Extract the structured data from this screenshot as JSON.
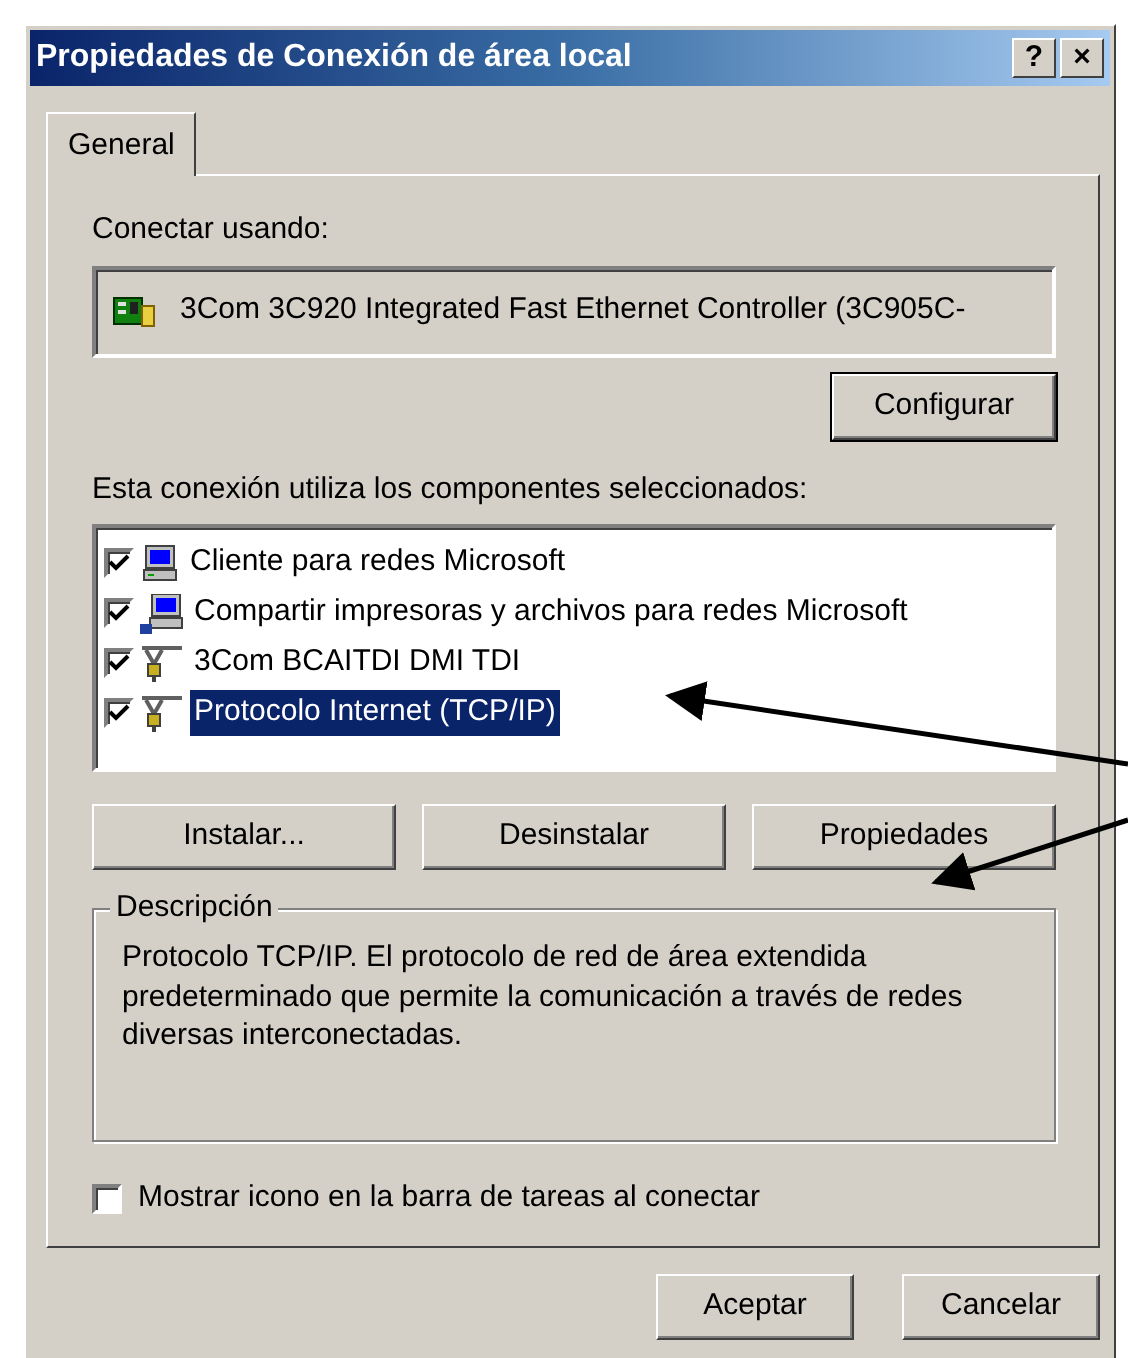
{
  "window": {
    "title": "Propiedades de Conexión de área local",
    "title_buttons": [
      "?",
      "×"
    ]
  },
  "tabs": [
    {
      "label": "General",
      "selected": true
    }
  ],
  "connect_label": "Conectar usando:",
  "adapter": {
    "name": "3Com 3C920 Integrated Fast Ethernet Controller (3C905C-"
  },
  "configure_button": "Configurar",
  "components_label": "Esta conexión utiliza los componentes seleccionados:",
  "components": [
    {
      "label": "Cliente para redes Microsoft",
      "kind": "client",
      "checked": true,
      "selected": false
    },
    {
      "label": "Compartir impresoras y archivos para redes Microsoft",
      "kind": "share",
      "checked": true,
      "selected": false
    },
    {
      "label": "3Com BCAITDI DMI TDI",
      "kind": "protocol",
      "checked": true,
      "selected": false
    },
    {
      "label": "Protocolo Internet (TCP/IP)",
      "kind": "protocol",
      "checked": true,
      "selected": true
    }
  ],
  "component_buttons": [
    "Instalar...",
    "Desinstalar",
    "Propiedades"
  ],
  "description": {
    "title": "Descripción",
    "text": "Protocolo TCP/IP. El protocolo de red de área extendida predeterminado que permite la comunicación a través de redes diversas interconectadas."
  },
  "show_icon": {
    "label": "Mostrar icono en la barra de tareas al conectar",
    "checked": false
  },
  "dialog_buttons": [
    "Aceptar",
    "Cancelar"
  ]
}
